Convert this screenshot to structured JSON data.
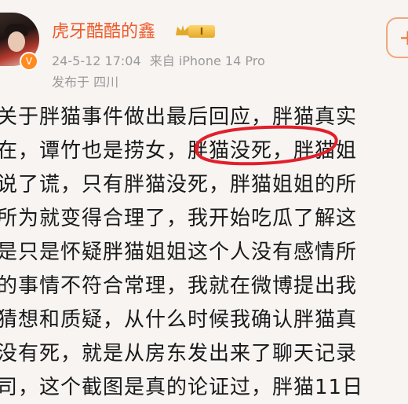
{
  "post": {
    "username": "虎牙酷酷的鑫",
    "level_badge": "I",
    "timestamp": "24-5-12 17:04",
    "source": "来自 iPhone 14 Pro",
    "location": "发布于 四川",
    "follow_label": "+",
    "verified_mark": "V"
  },
  "content_lines": [
    "关于胖猫事件做出最后回应，胖猫真实",
    "在，谭竹也是捞女，胖猫没死，胖猫姐",
    "说了谎，只有胖猫没死，胖猫姐姐的所",
    "所为就变得合理了，我开始吃瓜了解这",
    "是只是怀疑胖猫姐姐这个人没有感情所",
    "的事情不符合常理，我就在微博提出我",
    "猜想和质疑，从什么时候我确认胖猫真",
    "没有死，就是从房东发出来了聊天记录",
    "司，这个截图是真的论证过，胖猫11日"
  ],
  "colors": {
    "username": "#ef5b2a",
    "circle": "#e0202a",
    "meta": "#9a9a9a"
  }
}
